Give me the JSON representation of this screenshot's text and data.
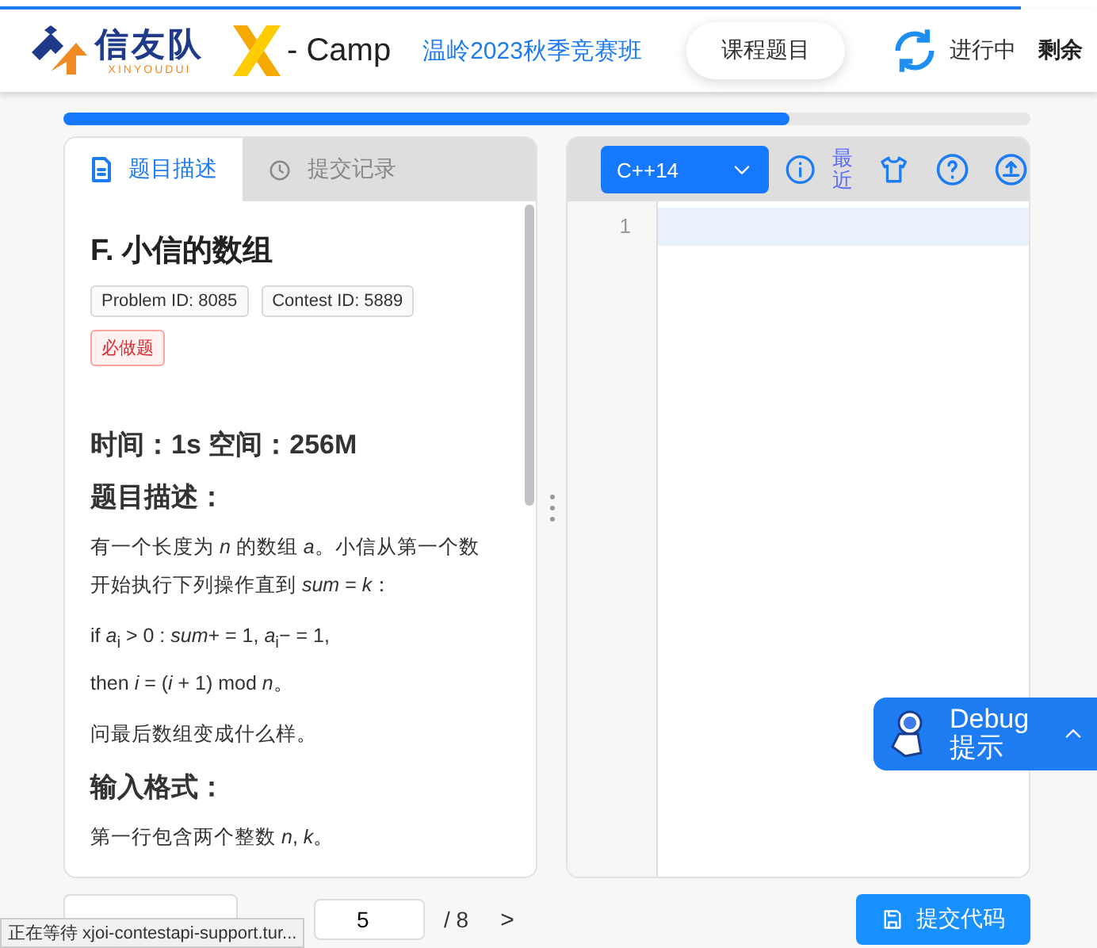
{
  "loading_bar": {
    "level": 0.93
  },
  "header": {
    "brand": "信友队",
    "brand_sub": "XINYOUDUI",
    "camp": "- Camp",
    "class_link": "温岭2023秋季竞赛班",
    "course_button": "课程题目",
    "status": "进行中",
    "remaining": "剩余"
  },
  "progress": {
    "level": 0.75
  },
  "tabs": [
    {
      "label": "题目描述",
      "selected": true
    },
    {
      "label": "提交记录",
      "selected": false
    }
  ],
  "problem": {
    "title": "F.  小信的数组",
    "tags": [
      {
        "text": "Problem ID: 8085",
        "kind": "plain"
      },
      {
        "text": "Contest ID: 5889",
        "kind": "plain"
      },
      {
        "text": "必做题",
        "kind": "required"
      }
    ],
    "limits": "时间：1s 空间：256M",
    "sections": [
      {
        "heading": "题目描述：",
        "paragraphs": [
          "有一个长度为 *n* 的数组 *a*。小信从第一个数开始执行下列操作直到 *sum* = *k*：",
          "if *a*$_{i}$ > 0 : *sum*+ = 1, *a*$_{i}$− = 1,\nthen *i* = (*i* + 1) mod *n*。",
          "问最后数组变成什么样。"
        ]
      },
      {
        "heading": "输入格式：",
        "paragraphs": [
          "第一行包含两个整数 *n*, *k*。"
        ]
      }
    ]
  },
  "editor": {
    "language": "C++14",
    "recent": "最近",
    "lines": [
      "1"
    ]
  },
  "debug": {
    "title": "Debug",
    "subtitle": "提示"
  },
  "pager": {
    "current": "5",
    "total": "/ 8",
    "next": ">"
  },
  "submit_button": "提交代码",
  "status_bar": "正在等待 xjoi-contestapi-support.tur..."
}
